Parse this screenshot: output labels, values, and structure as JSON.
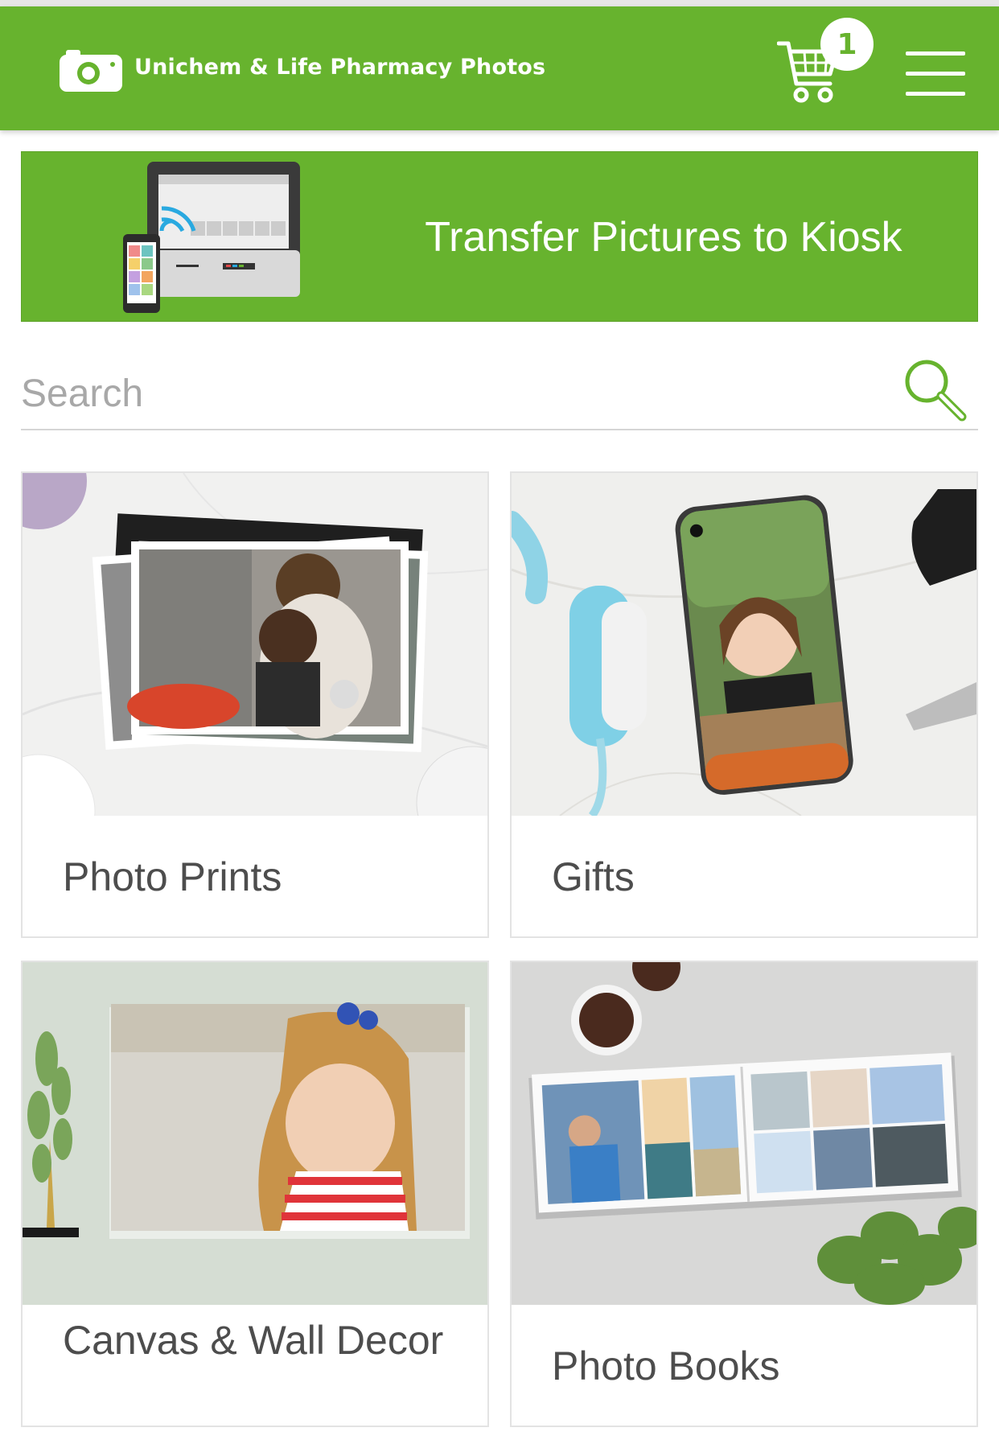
{
  "header": {
    "brand": "Unichem & Life Pharmacy Photos",
    "cart_count": "1",
    "accent_color": "#67b32e",
    "icons": [
      "camera-logo-icon",
      "cart-icon",
      "hamburger-menu-icon"
    ]
  },
  "kiosk_banner": {
    "label": "Transfer Pictures to Kiosk",
    "icon": "kiosk-transfer-illustration"
  },
  "search": {
    "placeholder": "Search",
    "icon": "search-icon"
  },
  "categories": [
    {
      "label": "Photo Prints"
    },
    {
      "label": "Gifts"
    },
    {
      "label": "Canvas & Wall Decor"
    },
    {
      "label": "Photo Books"
    }
  ]
}
